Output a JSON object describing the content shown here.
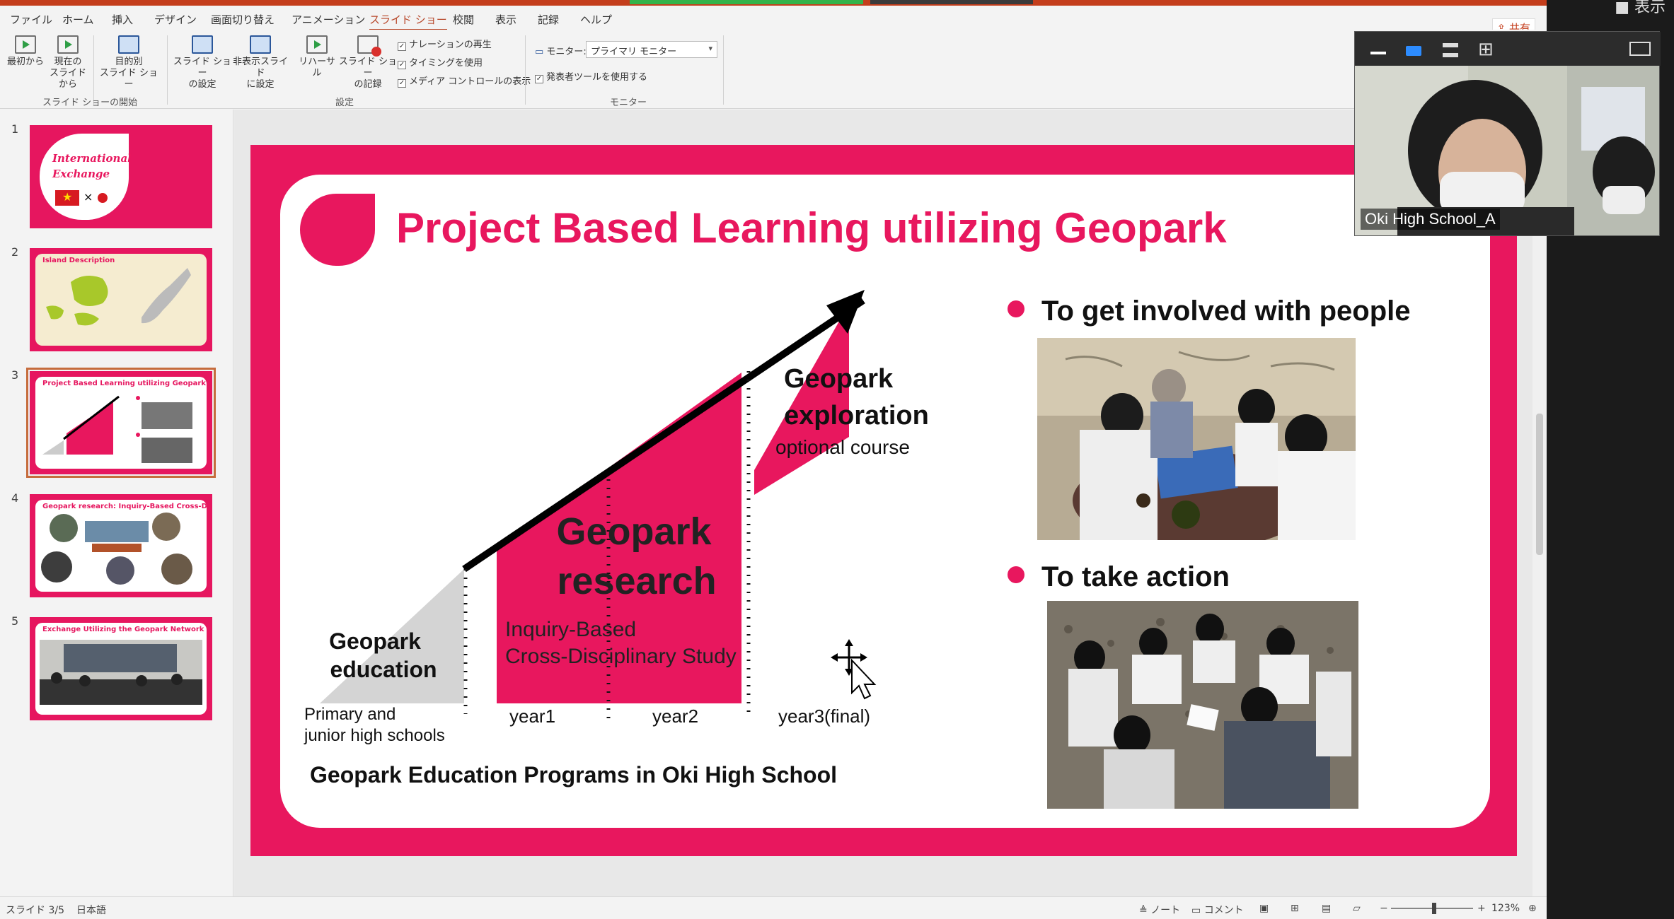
{
  "menu": {
    "tabs": [
      "ファイル",
      "ホーム",
      "挿入",
      "デザイン",
      "画面切り替え",
      "アニメーション",
      "スライド ショー",
      "校閲",
      "表示",
      "記録",
      "ヘルプ"
    ],
    "share": "共有"
  },
  "ribbon": {
    "from_beginning": "最初から",
    "from_current_1": "現在の",
    "from_current_2": "スライドから",
    "custom_1": "目的別",
    "custom_2": "スライド ショー",
    "group_start": "スライド ショーの開始",
    "setup_1": "スライド ショー",
    "setup_2": "の設定",
    "hide_1": "非表示スライド",
    "hide_2": "に設定",
    "rehearse": "リハーサル",
    "record_1": "スライド ショー",
    "record_2": "の記録",
    "chk_narration": "ナレーションの再生",
    "chk_timing": "タイミングを使用",
    "chk_media": "メディア コントロールの表示",
    "group_setup": "設定",
    "monitor_label": "モニター:",
    "monitor_value": "プライマリ モニター",
    "chk_presenter": "発表者ツールを使用する",
    "group_monitor": "モニター"
  },
  "thumbnails": [
    {
      "num": "1",
      "title": "International Exchange"
    },
    {
      "num": "2",
      "title": "Island Description"
    },
    {
      "num": "3",
      "title": "Project Based Learning utilizing Geopark"
    },
    {
      "num": "4",
      "title": "Geopark research: Inquiry-Based Cross-Disciplinary Study"
    },
    {
      "num": "5",
      "title": "Exchange Utilizing the Geopark Network"
    }
  ],
  "slide": {
    "title": "Project Based Learning utilizing Geopark",
    "bullet1": "To get involved with people",
    "bullet2": "To take action",
    "footer": "Geopark Education Programs in Oki High School",
    "diagram": {
      "edu_1": "Geopark",
      "edu_2": "education",
      "research_1": "Geopark",
      "research_2": "research",
      "inquiry_1": "Inquiry-Based",
      "inquiry_2": "Cross-Disciplinary Study",
      "exploration_1": "Geopark",
      "exploration_2": "exploration",
      "optional": "optional course",
      "stage_primary_1": "Primary and",
      "stage_primary_2": "junior high schools",
      "stage_year1": "year1",
      "stage_year2": "year2",
      "stage_year3": "year3(final)"
    }
  },
  "status": {
    "slide_count": "スライド 3/5",
    "language": "日本語",
    "notes": "ノート",
    "comments": "コメント",
    "zoom": "123%"
  },
  "zoom_overlay": {
    "top_label": "表示",
    "participant_name": "Oki High School_A"
  },
  "colors": {
    "accent_pink": "#e8175e",
    "ribbon_accent": "#c43e1c"
  }
}
